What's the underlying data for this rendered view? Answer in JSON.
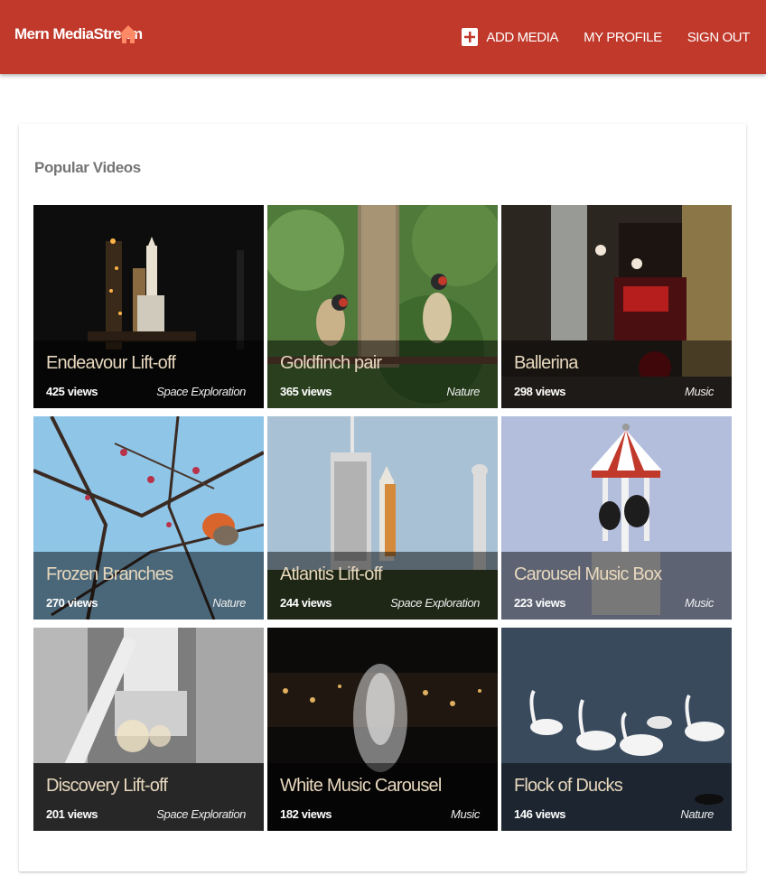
{
  "header": {
    "brand": "Mern MediaStream",
    "nav": {
      "add_media": "ADD MEDIA",
      "my_profile": "MY PROFILE",
      "sign_out": "SIGN OUT"
    },
    "colors": {
      "bar": "#c0392b",
      "home_icon": "#ff8a65"
    }
  },
  "section": {
    "title": "Popular Videos"
  },
  "videos": [
    {
      "title": "Endeavour Lift-off",
      "views": "425 views",
      "genre": "Space Exploration"
    },
    {
      "title": "Goldfinch pair",
      "views": "365 views",
      "genre": "Nature"
    },
    {
      "title": "Ballerina",
      "views": "298 views",
      "genre": "Music"
    },
    {
      "title": "Frozen Branches",
      "views": "270 views",
      "genre": "Nature"
    },
    {
      "title": "Atlantis Lift-off",
      "views": "244 views",
      "genre": "Space Exploration"
    },
    {
      "title": "Carousel Music Box",
      "views": "223 views",
      "genre": "Music"
    },
    {
      "title": "Discovery Lift-off",
      "views": "201 views",
      "genre": "Space Exploration"
    },
    {
      "title": "White Music Carousel",
      "views": "182 views",
      "genre": "Music"
    },
    {
      "title": "Flock of Ducks",
      "views": "146 views",
      "genre": "Nature"
    }
  ]
}
